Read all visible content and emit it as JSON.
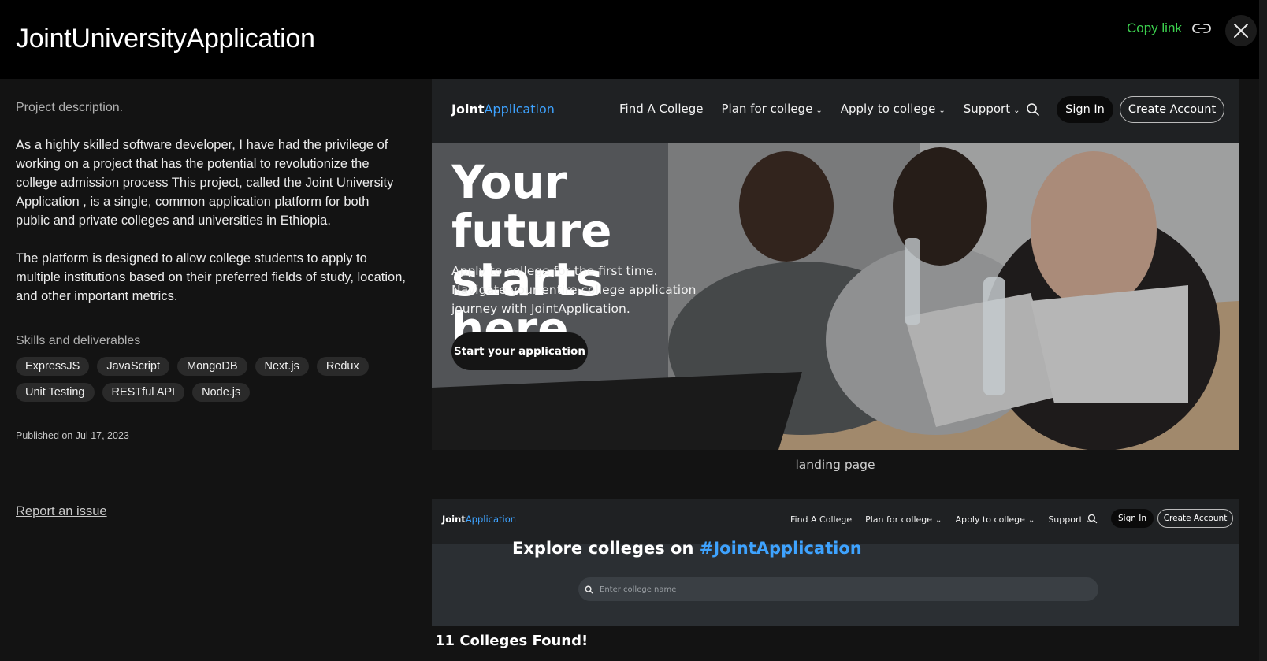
{
  "header": {
    "title": "JointUniversityApplication",
    "copy_link_label": "Copy link",
    "close_icon": "close-icon",
    "link_icon": "link-icon"
  },
  "left": {
    "description_heading": "Project description.",
    "paragraph_1": "As a highly skilled software developer, I have had the privilege of working on a project that has the potential to revolutionize the college admission process This project, called the Joint University Application , is a single, common application platform for both public and private colleges and universities in Ethiopia.",
    "paragraph_2": "The platform is designed to allow college students to apply to multiple institutions based on their preferred fields of study, location, and other important metrics.",
    "skills_heading": "Skills and deliverables",
    "skills": [
      "ExpressJS",
      "JavaScript",
      "MongoDB",
      "Next.js",
      "Redux",
      "Unit Testing",
      "RESTful API",
      "Node.js"
    ],
    "published": "Published on Jul 17, 2023",
    "report_label": "Report an issue"
  },
  "site1": {
    "logo_main": "Joint",
    "logo_accent": "Application",
    "nav": {
      "find": "Find A College",
      "plan": "Plan for college",
      "apply": "Apply to college",
      "support": "Support"
    },
    "sign_in": "Sign In",
    "create_account": "Create Account",
    "hero_title": "Your future starts here",
    "hero_subtitle": "Apply to college for the first time. Navigate your entire college application journey with JointApplication.",
    "start_button": "Start your application",
    "caption": "landing page"
  },
  "site2": {
    "logo_main": "Joint",
    "logo_accent": "Application",
    "nav": {
      "find": "Find A College",
      "plan": "Plan for college",
      "apply": "Apply to college",
      "support": "Support"
    },
    "sign_in": "Sign In",
    "create_account": "Create Account",
    "explore_prefix": "Explore colleges on ",
    "explore_hashtag": "#JointApplication",
    "search_placeholder": "Enter college name",
    "found_text": "11 Colleges Found!"
  },
  "colors": {
    "accent_green": "#3ccf4e",
    "accent_blue": "#3ea3ff",
    "background": "#131313"
  }
}
